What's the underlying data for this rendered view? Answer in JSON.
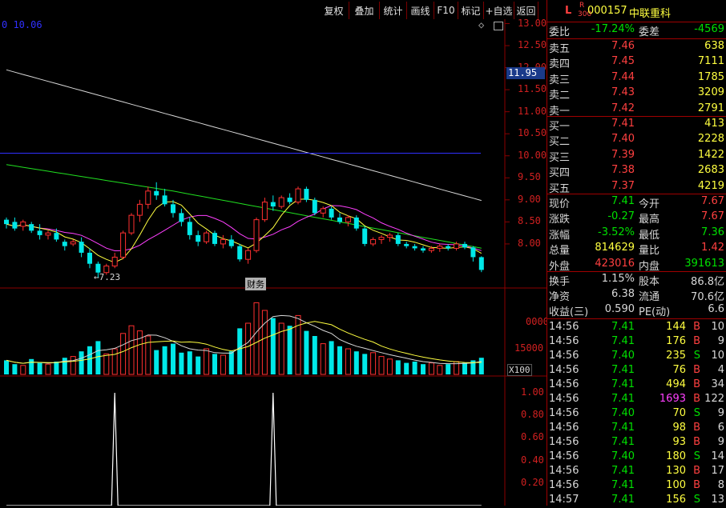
{
  "toolbar": {
    "buttons": [
      "复权",
      "叠加",
      "统计",
      "画线",
      "F10",
      "标记",
      "+自选",
      "返回"
    ]
  },
  "chart": {
    "ma_readout": "0 10.06",
    "price_ticks": [
      "13.00",
      "12.50",
      "12.00",
      "11.50",
      "11.00",
      "10.50",
      "10.00",
      "9.50",
      "9.00",
      "8.50",
      "8.00"
    ],
    "current_price_tag": "11.95",
    "low_marker": "7.23",
    "report_badge": "财务",
    "volume_ticks": [
      "0000",
      "15000"
    ],
    "volume_unit": "X100",
    "indicator_ticks": [
      "1.00",
      "0.80",
      "0.60",
      "0.40",
      "0.20"
    ],
    "colors": {
      "up": "#ff3030",
      "down": "#00e8e8",
      "grid": "#8b0000",
      "ma_white": "#d8d8d8",
      "ma_yellow": "#ffff40",
      "ma_magenta": "#ff40ff",
      "ma_green": "#20e020",
      "ma_blue": "#3030ff"
    },
    "chart_data": {
      "type": "candlestick",
      "candles": [
        {
          "o": 8.55,
          "h": 8.6,
          "l": 8.35,
          "c": 8.45
        },
        {
          "o": 8.5,
          "h": 8.6,
          "l": 8.3,
          "c": 8.35
        },
        {
          "o": 8.4,
          "h": 8.55,
          "l": 8.3,
          "c": 8.5
        },
        {
          "o": 8.45,
          "h": 8.5,
          "l": 8.25,
          "c": 8.3
        },
        {
          "o": 8.3,
          "h": 8.45,
          "l": 8.1,
          "c": 8.2
        },
        {
          "o": 8.2,
          "h": 8.3,
          "l": 8.1,
          "c": 8.25
        },
        {
          "o": 8.25,
          "h": 8.35,
          "l": 8.05,
          "c": 8.1
        },
        {
          "o": 8.05,
          "h": 8.1,
          "l": 7.85,
          "c": 7.95
        },
        {
          "o": 8.0,
          "h": 8.1,
          "l": 7.95,
          "c": 8.05
        },
        {
          "o": 8.05,
          "h": 8.15,
          "l": 7.7,
          "c": 7.8
        },
        {
          "o": 7.8,
          "h": 7.9,
          "l": 7.45,
          "c": 7.55
        },
        {
          "o": 7.55,
          "h": 7.6,
          "l": 7.23,
          "c": 7.35
        },
        {
          "o": 7.35,
          "h": 7.55,
          "l": 7.3,
          "c": 7.5
        },
        {
          "o": 7.5,
          "h": 7.8,
          "l": 7.45,
          "c": 7.7
        },
        {
          "o": 7.7,
          "h": 8.3,
          "l": 7.65,
          "c": 8.25
        },
        {
          "o": 8.25,
          "h": 8.7,
          "l": 8.2,
          "c": 8.65
        },
        {
          "o": 8.65,
          "h": 9.0,
          "l": 8.5,
          "c": 8.9
        },
        {
          "o": 8.9,
          "h": 9.3,
          "l": 8.8,
          "c": 9.2
        },
        {
          "o": 9.2,
          "h": 9.4,
          "l": 9.0,
          "c": 9.1
        },
        {
          "o": 9.1,
          "h": 9.25,
          "l": 8.85,
          "c": 8.9
        },
        {
          "o": 8.9,
          "h": 9.0,
          "l": 8.6,
          "c": 8.7
        },
        {
          "o": 8.7,
          "h": 8.8,
          "l": 8.4,
          "c": 8.5
        },
        {
          "o": 8.5,
          "h": 8.6,
          "l": 8.1,
          "c": 8.2
        },
        {
          "o": 8.2,
          "h": 8.3,
          "l": 7.95,
          "c": 8.05
        },
        {
          "o": 8.05,
          "h": 8.3,
          "l": 8.0,
          "c": 8.25
        },
        {
          "o": 8.25,
          "h": 8.3,
          "l": 7.95,
          "c": 8.0
        },
        {
          "o": 8.0,
          "h": 8.2,
          "l": 7.9,
          "c": 8.1
        },
        {
          "o": 8.1,
          "h": 8.2,
          "l": 7.9,
          "c": 7.95
        },
        {
          "o": 7.95,
          "h": 8.0,
          "l": 7.6,
          "c": 7.65
        },
        {
          "o": 7.65,
          "h": 7.9,
          "l": 7.55,
          "c": 7.85
        },
        {
          "o": 7.85,
          "h": 8.6,
          "l": 7.8,
          "c": 8.55
        },
        {
          "o": 8.55,
          "h": 9.05,
          "l": 8.5,
          "c": 8.95
        },
        {
          "o": 8.95,
          "h": 9.1,
          "l": 8.75,
          "c": 8.85
        },
        {
          "o": 8.85,
          "h": 9.1,
          "l": 8.8,
          "c": 9.05
        },
        {
          "o": 9.05,
          "h": 9.15,
          "l": 8.9,
          "c": 8.95
        },
        {
          "o": 8.95,
          "h": 9.3,
          "l": 8.9,
          "c": 9.25
        },
        {
          "o": 9.25,
          "h": 9.3,
          "l": 8.95,
          "c": 9.0
        },
        {
          "o": 9.0,
          "h": 9.05,
          "l": 8.65,
          "c": 8.7
        },
        {
          "o": 8.7,
          "h": 8.85,
          "l": 8.6,
          "c": 8.8
        },
        {
          "o": 8.8,
          "h": 8.85,
          "l": 8.55,
          "c": 8.6
        },
        {
          "o": 8.6,
          "h": 8.7,
          "l": 8.45,
          "c": 8.5
        },
        {
          "o": 8.5,
          "h": 8.65,
          "l": 8.4,
          "c": 8.6
        },
        {
          "o": 8.6,
          "h": 8.65,
          "l": 8.3,
          "c": 8.35
        },
        {
          "o": 8.35,
          "h": 8.4,
          "l": 7.95,
          "c": 8.0
        },
        {
          "o": 8.0,
          "h": 8.15,
          "l": 7.95,
          "c": 8.1
        },
        {
          "o": 8.1,
          "h": 8.2,
          "l": 8.0,
          "c": 8.15
        },
        {
          "o": 8.15,
          "h": 8.25,
          "l": 8.05,
          "c": 8.2
        },
        {
          "o": 8.2,
          "h": 8.25,
          "l": 7.95,
          "c": 8.0
        },
        {
          "o": 8.0,
          "h": 8.05,
          "l": 7.9,
          "c": 7.95
        },
        {
          "o": 7.95,
          "h": 8.0,
          "l": 7.85,
          "c": 7.9
        },
        {
          "o": 7.9,
          "h": 7.95,
          "l": 7.8,
          "c": 7.85
        },
        {
          "o": 7.85,
          "h": 7.95,
          "l": 7.8,
          "c": 7.9
        },
        {
          "o": 7.9,
          "h": 8.0,
          "l": 7.82,
          "c": 7.95
        },
        {
          "o": 7.95,
          "h": 8.0,
          "l": 7.85,
          "c": 7.9
        },
        {
          "o": 7.9,
          "h": 8.05,
          "l": 7.85,
          "c": 8.0
        },
        {
          "o": 8.0,
          "h": 8.05,
          "l": 7.88,
          "c": 7.92
        },
        {
          "o": 7.92,
          "h": 7.95,
          "l": 7.6,
          "c": 7.7
        },
        {
          "o": 7.7,
          "h": 7.72,
          "l": 7.36,
          "c": 7.41
        }
      ],
      "volumes": [
        55,
        40,
        35,
        60,
        45,
        40,
        50,
        65,
        70,
        90,
        110,
        130,
        80,
        100,
        160,
        190,
        170,
        150,
        95,
        110,
        120,
        85,
        90,
        70,
        100,
        80,
        75,
        90,
        180,
        200,
        280,
        250,
        220,
        200,
        190,
        230,
        170,
        150,
        120,
        130,
        110,
        100,
        90,
        80,
        85,
        70,
        60,
        55,
        45,
        50,
        40,
        45,
        35,
        40,
        50,
        45,
        55,
        65
      ],
      "indicator": [
        0,
        0,
        0,
        0,
        0,
        0,
        0,
        0,
        0,
        0,
        0,
        0,
        0,
        1,
        0,
        0,
        0,
        0,
        0,
        0,
        0,
        0,
        0,
        0,
        0,
        0,
        0,
        0,
        0,
        0,
        0,
        0,
        1,
        0,
        0,
        0,
        0,
        0,
        0,
        0,
        0,
        0,
        0,
        0,
        0,
        0,
        0,
        0,
        0,
        0,
        0,
        0,
        0,
        0,
        0,
        0,
        0,
        0
      ],
      "ylim": [
        7.0,
        13.1
      ],
      "vol_max": 300,
      "indicator_ylim": [
        0,
        1.05
      ]
    }
  },
  "quote": {
    "header": {
      "flag": "L",
      "index_top": "R",
      "index_bottom": "300",
      "code": "000157",
      "name": "中联重科"
    },
    "wei": {
      "wb_label": "委比",
      "wb_value": "-17.24%",
      "wc_label": "委差",
      "wc_value": "-4569"
    },
    "asks": [
      {
        "label": "卖五",
        "price": "7.46",
        "vol": "638"
      },
      {
        "label": "卖四",
        "price": "7.45",
        "vol": "7111"
      },
      {
        "label": "卖三",
        "price": "7.44",
        "vol": "1785"
      },
      {
        "label": "卖二",
        "price": "7.43",
        "vol": "3209"
      },
      {
        "label": "卖一",
        "price": "7.42",
        "vol": "2791"
      }
    ],
    "bids": [
      {
        "label": "买一",
        "price": "7.41",
        "vol": "413"
      },
      {
        "label": "买二",
        "price": "7.40",
        "vol": "2228"
      },
      {
        "label": "买三",
        "price": "7.39",
        "vol": "1422"
      },
      {
        "label": "买四",
        "price": "7.38",
        "vol": "2683"
      },
      {
        "label": "买五",
        "price": "7.37",
        "vol": "4219"
      }
    ],
    "stats": [
      {
        "l1": "现价",
        "v1": "7.41",
        "c1": "grn",
        "l2": "今开",
        "v2": "7.67",
        "c2": "red"
      },
      {
        "l1": "涨跌",
        "v1": "-0.27",
        "c1": "grn",
        "l2": "最高",
        "v2": "7.67",
        "c2": "red"
      },
      {
        "l1": "涨幅",
        "v1": "-3.52%",
        "c1": "grn",
        "l2": "最低",
        "v2": "7.36",
        "c2": "grn"
      },
      {
        "l1": "总量",
        "v1": "814629",
        "c1": "yel",
        "l2": "量比",
        "v2": "1.42",
        "c2": "red"
      },
      {
        "l1": "外盘",
        "v1": "423016",
        "c1": "red",
        "l2": "内盘",
        "v2": "391613",
        "c2": "grn"
      }
    ],
    "fin": [
      {
        "l1": "换手",
        "v1": "1.15%",
        "l2": "股本",
        "v2": "86.8亿"
      },
      {
        "l1": "净资",
        "v1": "6.38",
        "l2": "流通",
        "v2": "70.6亿"
      },
      {
        "l1": "收益(三)",
        "v1": "0.590",
        "l2": "PE(动)",
        "v2": "6.6"
      }
    ],
    "ticks": [
      {
        "time": "14:56",
        "price": "7.41",
        "vol": "144",
        "bs": "B",
        "n": "10",
        "vc": "yel"
      },
      {
        "time": "14:56",
        "price": "7.41",
        "vol": "176",
        "bs": "B",
        "n": "9",
        "vc": "yel"
      },
      {
        "time": "14:56",
        "price": "7.40",
        "vol": "235",
        "bs": "S",
        "n": "10",
        "vc": "yel"
      },
      {
        "time": "14:56",
        "price": "7.41",
        "vol": "76",
        "bs": "B",
        "n": "4",
        "vc": "yel"
      },
      {
        "time": "14:56",
        "price": "7.41",
        "vol": "494",
        "bs": "B",
        "n": "34",
        "vc": "yel"
      },
      {
        "time": "14:56",
        "price": "7.41",
        "vol": "1693",
        "bs": "B",
        "n": "122",
        "vc": "mag"
      },
      {
        "time": "14:56",
        "price": "7.40",
        "vol": "70",
        "bs": "S",
        "n": "9",
        "vc": "yel"
      },
      {
        "time": "14:56",
        "price": "7.41",
        "vol": "98",
        "bs": "B",
        "n": "6",
        "vc": "yel"
      },
      {
        "time": "14:56",
        "price": "7.41",
        "vol": "93",
        "bs": "B",
        "n": "9",
        "vc": "yel"
      },
      {
        "time": "14:56",
        "price": "7.40",
        "vol": "180",
        "bs": "S",
        "n": "14",
        "vc": "yel"
      },
      {
        "time": "14:56",
        "price": "7.41",
        "vol": "130",
        "bs": "B",
        "n": "17",
        "vc": "yel"
      },
      {
        "time": "14:56",
        "price": "7.41",
        "vol": "100",
        "bs": "B",
        "n": "8",
        "vc": "yel"
      },
      {
        "time": "14:57",
        "price": "7.41",
        "vol": "156",
        "bs": "S",
        "n": "13",
        "vc": "yel"
      }
    ]
  }
}
